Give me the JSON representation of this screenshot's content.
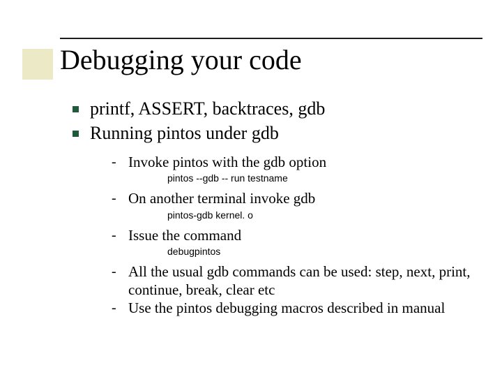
{
  "title": "Debugging your code",
  "bullets": {
    "b1": "printf, ASSERT, backtraces, gdb",
    "b2": "Running pintos under gdb"
  },
  "sub": {
    "s1": "Invoke pintos with the gdb option",
    "c1": "pintos --gdb -- run testname",
    "s2": "On another terminal invoke gdb",
    "c2": "pintos-gdb kernel. o",
    "s3": "Issue the command",
    "c3": "debugpintos",
    "s4": "All the usual gdb commands can be used: step, next, print, continue, break, clear etc",
    "s5": "Use the pintos debugging macros described in manual"
  },
  "colors": {
    "bullet": "#1f5a3a",
    "accent": "#ece9c6"
  }
}
